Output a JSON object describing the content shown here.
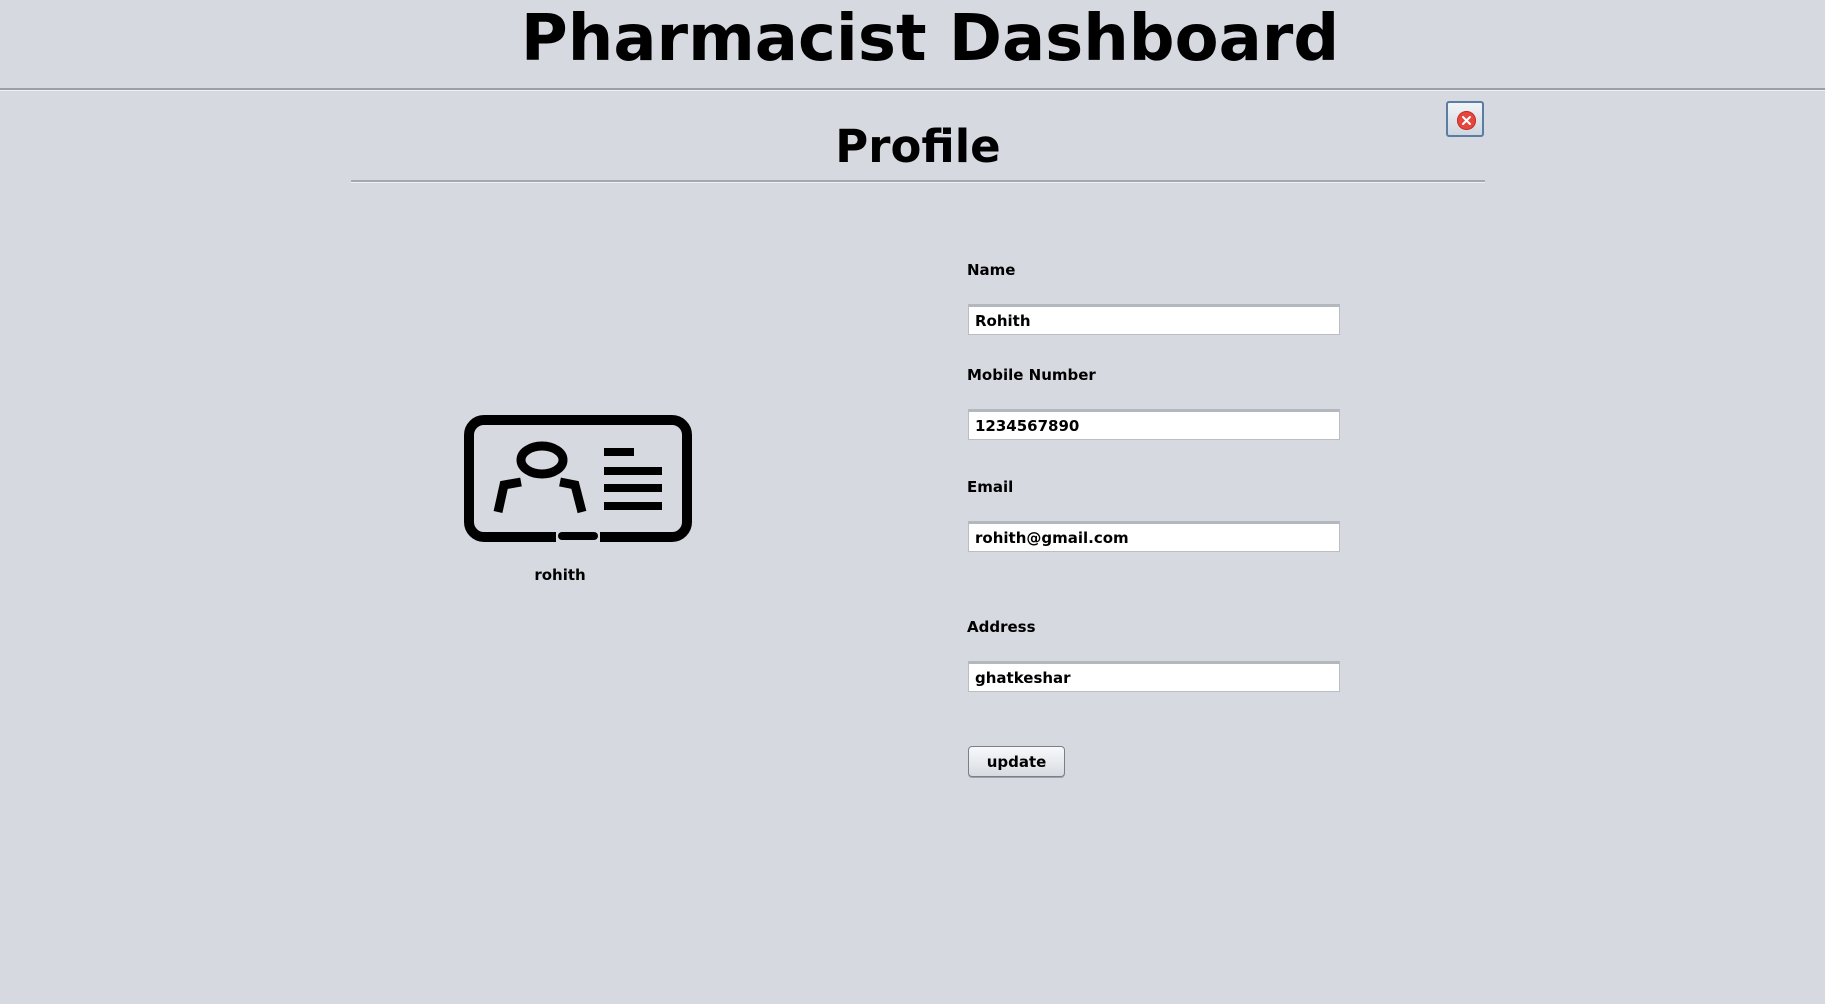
{
  "header": {
    "title": "Pharmacist Dashboard"
  },
  "profile": {
    "title": "Profile",
    "username": "rohith",
    "avatar_icon": "id-card-icon",
    "close_icon": "close-icon"
  },
  "form": {
    "name": {
      "label": "Name",
      "value": "Rohith"
    },
    "mobile": {
      "label": "Mobile Number",
      "value": "1234567890"
    },
    "email": {
      "label": "Email",
      "value": "rohith@gmail.com"
    },
    "address": {
      "label": "Address",
      "value": "ghatkeshar"
    },
    "update_label": "update"
  },
  "colors": {
    "background": "#d6d9e0",
    "close_accent": "#e5463e"
  }
}
